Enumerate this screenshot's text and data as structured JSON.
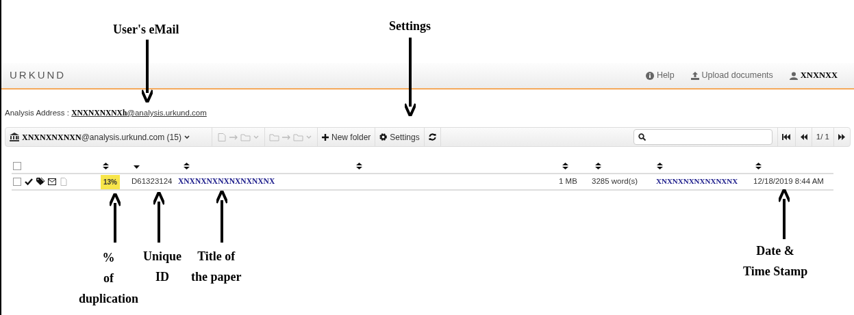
{
  "annotations": [
    {
      "text": "User's eMail",
      "kind": "arrow_down"
    },
    {
      "text": "Settings",
      "kind": "arrow_down"
    },
    {
      "text": "%\nof\nduplication",
      "kind": "arrow_up"
    },
    {
      "text": "Unique\nID",
      "kind": "arrow_up"
    },
    {
      "text": "Title of\nthe paper",
      "kind": "arrow_up"
    },
    {
      "text": "Date &\nTime Stamp",
      "kind": "arrow_up"
    }
  ],
  "header": {
    "logo": "URKUND",
    "links": [
      {
        "kind": "help",
        "label": "Help"
      },
      {
        "kind": "upload",
        "label": "Upload documents"
      },
      {
        "kind": "user",
        "label": "XNXNXX"
      }
    ]
  },
  "analysis_address": {
    "label": "Analysis Address :",
    "redacted": "XNXNXNXNXh",
    "domain": "@analysis.urkund.com"
  },
  "toolbar": {
    "account": {
      "redacted": "XNXNXNXNXN",
      "text": "@analysis.urkund.com (15)"
    },
    "new_folder": "New folder",
    "settings": "Settings",
    "page": "1/ 1"
  },
  "table": {
    "select_all": {
      "checked": false
    },
    "columns": [
      {
        "sorted": false
      },
      {
        "sorted": true
      },
      {
        "sorted": false
      },
      {
        "sorted": false
      },
      {
        "sorted": false
      },
      {
        "sorted": false
      },
      {
        "sorted": false
      },
      {
        "sorted": false
      }
    ],
    "rows": [
      {
        "checked": false,
        "percent": "13%",
        "id": "D61323124",
        "title": "XNXNXNXNXNXNXNXNX",
        "size": "1 MB",
        "words": "3285 word(s)",
        "sender": "XNXNXNXNXNXNXNX",
        "date": "12/18/2019 8:44 AM"
      }
    ]
  }
}
